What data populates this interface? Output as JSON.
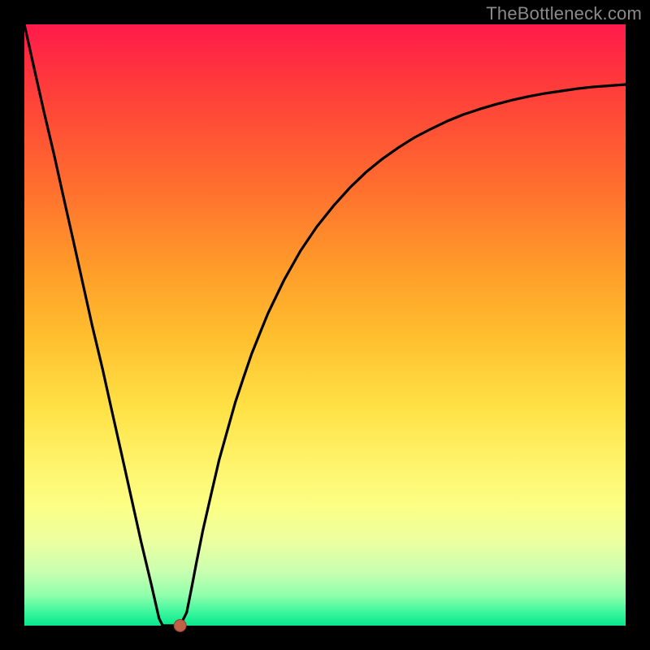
{
  "watermark": "TheBottleneck.com",
  "colors": {
    "frame": "#000000",
    "curve": "#000000",
    "marker_fill": "#c06048",
    "marker_stroke": "#8a3f30"
  },
  "chart_data": {
    "type": "line",
    "title": "",
    "xlabel": "",
    "ylabel": "",
    "xlim": [
      0,
      1
    ],
    "ylim": [
      0,
      1
    ],
    "x": [
      0.0,
      0.016,
      0.032,
      0.049,
      0.065,
      0.081,
      0.097,
      0.113,
      0.13,
      0.146,
      0.162,
      0.178,
      0.194,
      0.211,
      0.224,
      0.23,
      0.235,
      0.243,
      0.251,
      0.259,
      0.27,
      0.278,
      0.286,
      0.297,
      0.311,
      0.324,
      0.338,
      0.351,
      0.365,
      0.378,
      0.392,
      0.405,
      0.432,
      0.459,
      0.486,
      0.514,
      0.541,
      0.568,
      0.595,
      0.622,
      0.649,
      0.676,
      0.703,
      0.73,
      0.757,
      0.784,
      0.811,
      0.838,
      0.865,
      0.892,
      0.919,
      0.946,
      0.973,
      1.0
    ],
    "values": [
      1.0,
      0.928,
      0.857,
      0.785,
      0.713,
      0.642,
      0.57,
      0.498,
      0.427,
      0.355,
      0.284,
      0.212,
      0.14,
      0.069,
      0.012,
      0.0,
      0.0,
      0.0,
      0.0,
      0.0,
      0.022,
      0.062,
      0.104,
      0.159,
      0.22,
      0.276,
      0.326,
      0.372,
      0.414,
      0.452,
      0.487,
      0.519,
      0.575,
      0.623,
      0.663,
      0.698,
      0.728,
      0.754,
      0.776,
      0.795,
      0.812,
      0.826,
      0.839,
      0.85,
      0.859,
      0.867,
      0.874,
      0.88,
      0.885,
      0.889,
      0.893,
      0.896,
      0.898,
      0.9
    ],
    "marker": {
      "x": 0.259,
      "y": 0.0
    },
    "notes": "x and y are normalized to [0,1]; y=0 is bottom (green), y=1 is top (red)."
  }
}
